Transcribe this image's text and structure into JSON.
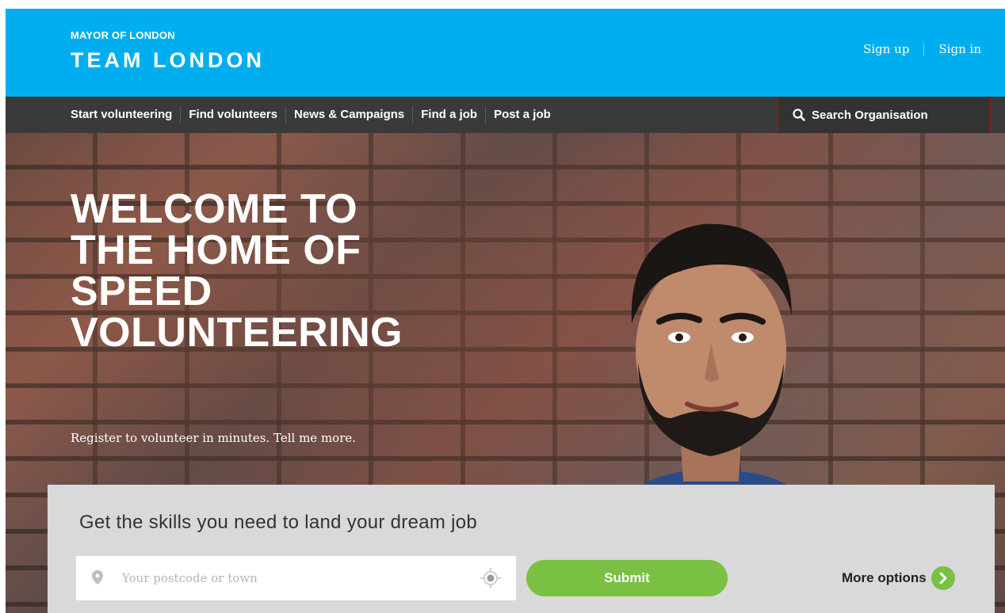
{
  "header": {
    "brand_top": "MAYOR OF LONDON",
    "brand_main": "TEAM LONDON",
    "sign_up": "Sign up",
    "sign_in": "Sign in"
  },
  "nav": {
    "items": [
      {
        "label": "Start volunteering"
      },
      {
        "label": "Find volunteers"
      },
      {
        "label": "News & Campaigns"
      },
      {
        "label": "Find a job"
      },
      {
        "label": "Post a job"
      }
    ],
    "search_label": "Search Organisation",
    "search_icon": "search-icon"
  },
  "hero": {
    "title_lines": [
      "WELCOME TO",
      "THE HOME OF",
      "SPEED",
      "VOLUNTEERING"
    ],
    "subtitle": "Register to volunteer in minutes. Tell me more."
  },
  "search_panel": {
    "title": "Get the skills you need to land your dream job",
    "location_placeholder": "Your postcode or town",
    "location_value": "",
    "pin_icon": "map-pin-icon",
    "locate_icon": "crosshair-locate-icon",
    "submit_label": "Submit",
    "more_options_label": "More options",
    "more_icon": "chevron-right-circle-icon"
  },
  "colors": {
    "header_blue": "#00aeef",
    "nav_dark": "#3a3a3a",
    "accent_green": "#7ac143",
    "search_border": "#8c1b1b"
  }
}
